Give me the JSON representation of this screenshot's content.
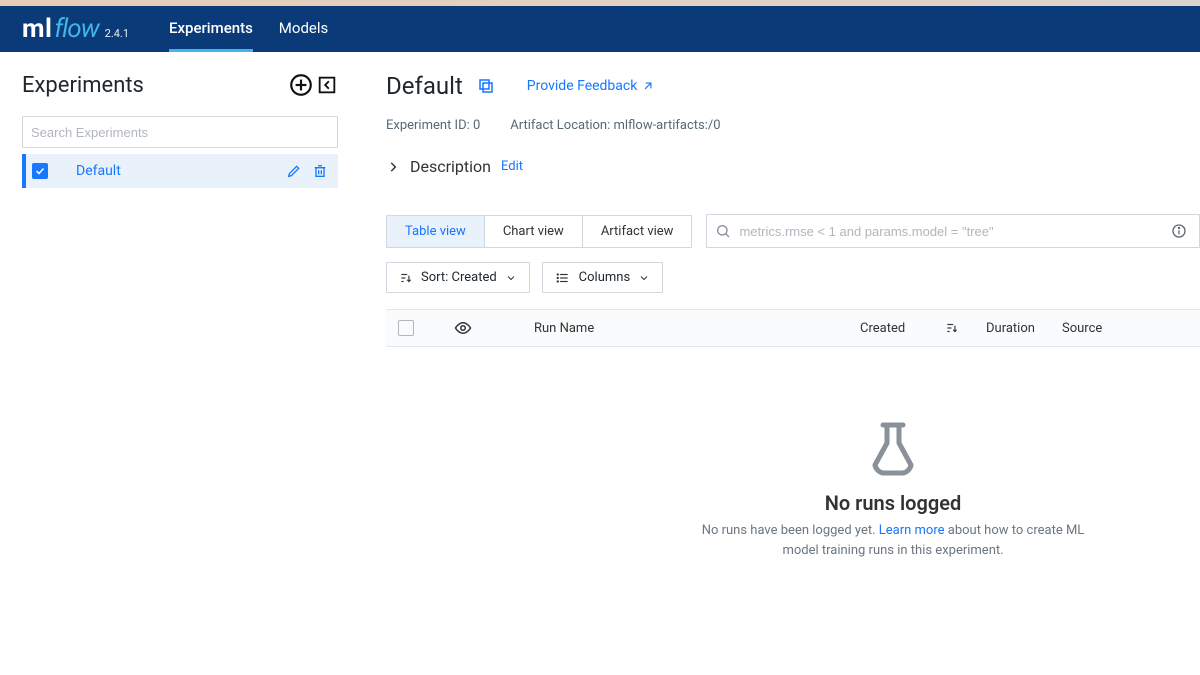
{
  "logo": {
    "ml": "ml",
    "flow": "flow",
    "version": "2.4.1"
  },
  "nav": {
    "experiments": "Experiments",
    "models": "Models"
  },
  "sidebar": {
    "title": "Experiments",
    "search_placeholder": "Search Experiments",
    "items": [
      {
        "label": "Default"
      }
    ]
  },
  "main": {
    "title": "Default",
    "feedback": "Provide Feedback",
    "experiment_id_label": "Experiment ID: 0",
    "artifact_location_label": "Artifact Location: mlflow-artifacts:/0",
    "description_label": "Description",
    "edit": "Edit",
    "views": {
      "table": "Table view",
      "chart": "Chart view",
      "artifact": "Artifact view"
    },
    "search_runs_placeholder": "metrics.rmse < 1 and params.model = \"tree\"",
    "sort_label": "Sort: Created",
    "columns_label": "Columns",
    "columns": {
      "run_name": "Run Name",
      "created": "Created",
      "duration": "Duration",
      "source": "Source"
    },
    "empty": {
      "title": "No runs logged",
      "sub_before": "No runs have been logged yet. ",
      "link": "Learn more",
      "sub_after": " about how to create ML model training runs in this experiment."
    }
  }
}
